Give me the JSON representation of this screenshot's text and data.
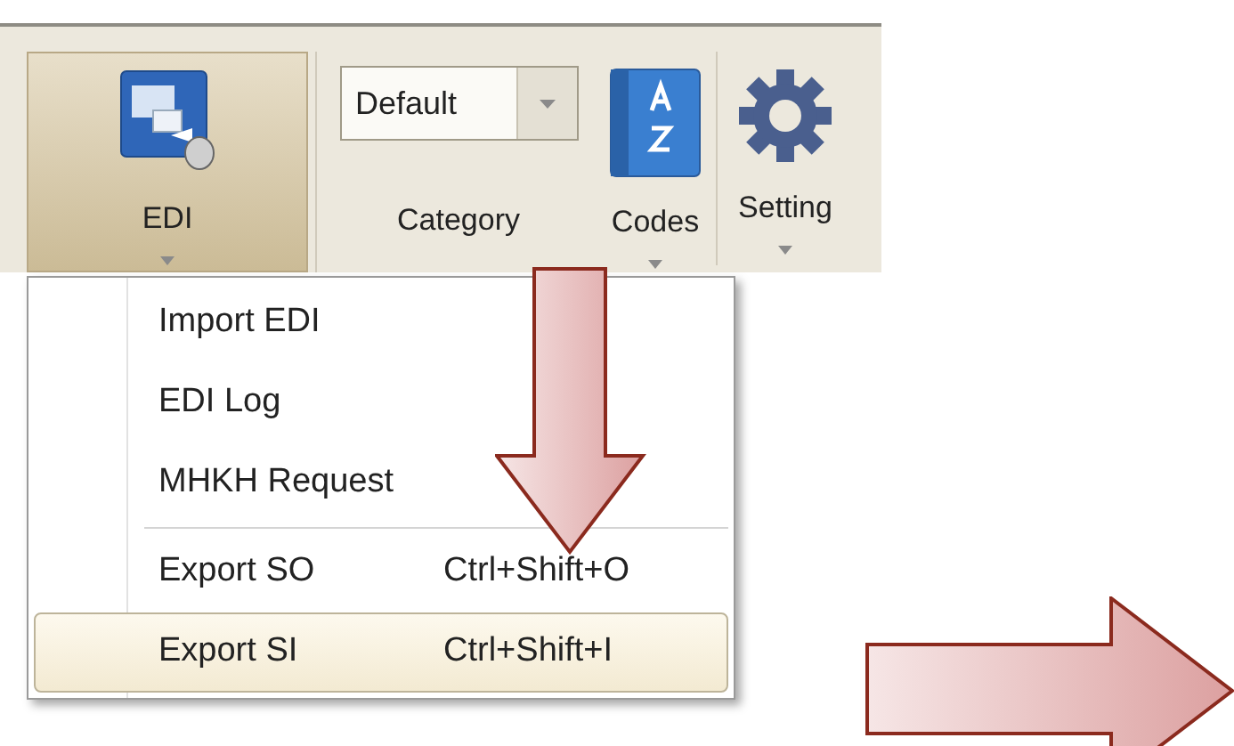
{
  "ribbon": {
    "buttons": [
      {
        "kind": "edi",
        "label": "EDI",
        "selected": true
      },
      {
        "kind": "category",
        "label": "Category",
        "value": "Default"
      },
      {
        "kind": "codes",
        "label": "Codes",
        "selected": false
      },
      {
        "kind": "settings",
        "label": "Setting",
        "selected": false
      }
    ]
  },
  "menu": {
    "groups": [
      [
        {
          "label": "Import EDI",
          "selected": false
        },
        {
          "label": "EDI Log",
          "selected": false
        },
        {
          "label": "MHKH Request",
          "selected": false
        }
      ],
      [
        {
          "label": "Export SO",
          "shortcut": "Ctrl+Shift+O",
          "selected": false
        },
        {
          "label": "Export SI",
          "shortcut": "Ctrl+Shift+I",
          "selected": true
        }
      ]
    ]
  }
}
